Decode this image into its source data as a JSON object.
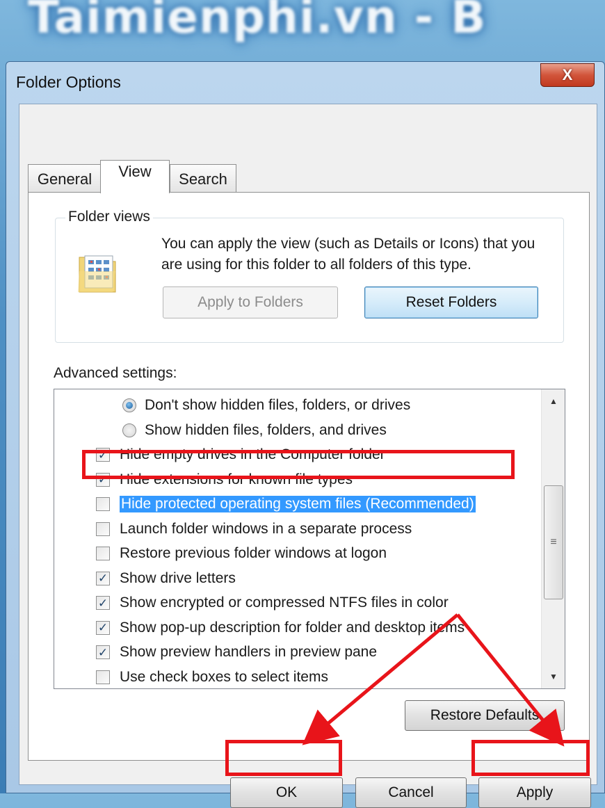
{
  "background": {
    "watermark": "Taimienphi.vn - B"
  },
  "window": {
    "title": "Folder Options",
    "close_label": "X"
  },
  "tabs": [
    {
      "label": "General",
      "active": false
    },
    {
      "label": "View",
      "active": true
    },
    {
      "label": "Search",
      "active": false
    }
  ],
  "folder_views": {
    "legend": "Folder views",
    "description": "You can apply the view (such as Details or Icons) that you are using for this folder to all folders of this type.",
    "apply_label": "Apply to Folders",
    "reset_label": "Reset Folders"
  },
  "advanced": {
    "label": "Advanced settings:",
    "items": [
      {
        "type": "radio",
        "label": "Don't show hidden files, folders, or drives",
        "checked": true
      },
      {
        "type": "radio",
        "label": "Show hidden files, folders, and drives",
        "checked": false
      },
      {
        "type": "checkbox",
        "label": "Hide empty drives in the Computer folder",
        "checked": true
      },
      {
        "type": "checkbox",
        "label": "Hide extensions for known file types",
        "checked": true
      },
      {
        "type": "checkbox",
        "label": "Hide protected operating system files (Recommended)",
        "checked": false,
        "selected": true
      },
      {
        "type": "checkbox",
        "label": "Launch folder windows in a separate process",
        "checked": false
      },
      {
        "type": "checkbox",
        "label": "Restore previous folder windows at logon",
        "checked": false
      },
      {
        "type": "checkbox",
        "label": "Show drive letters",
        "checked": true
      },
      {
        "type": "checkbox",
        "label": "Show encrypted or compressed NTFS files in color",
        "checked": true
      },
      {
        "type": "checkbox",
        "label": "Show pop-up description for folder and desktop items",
        "checked": true
      },
      {
        "type": "checkbox",
        "label": "Show preview handlers in preview pane",
        "checked": true
      },
      {
        "type": "checkbox",
        "label": "Use check boxes to select items",
        "checked": false
      }
    ],
    "restore_label": "Restore Defaults"
  },
  "footer": {
    "ok_label": "OK",
    "cancel_label": "Cancel",
    "apply_label": "Apply"
  },
  "colors": {
    "highlight": "#e8141a",
    "selection": "#3399ff"
  }
}
